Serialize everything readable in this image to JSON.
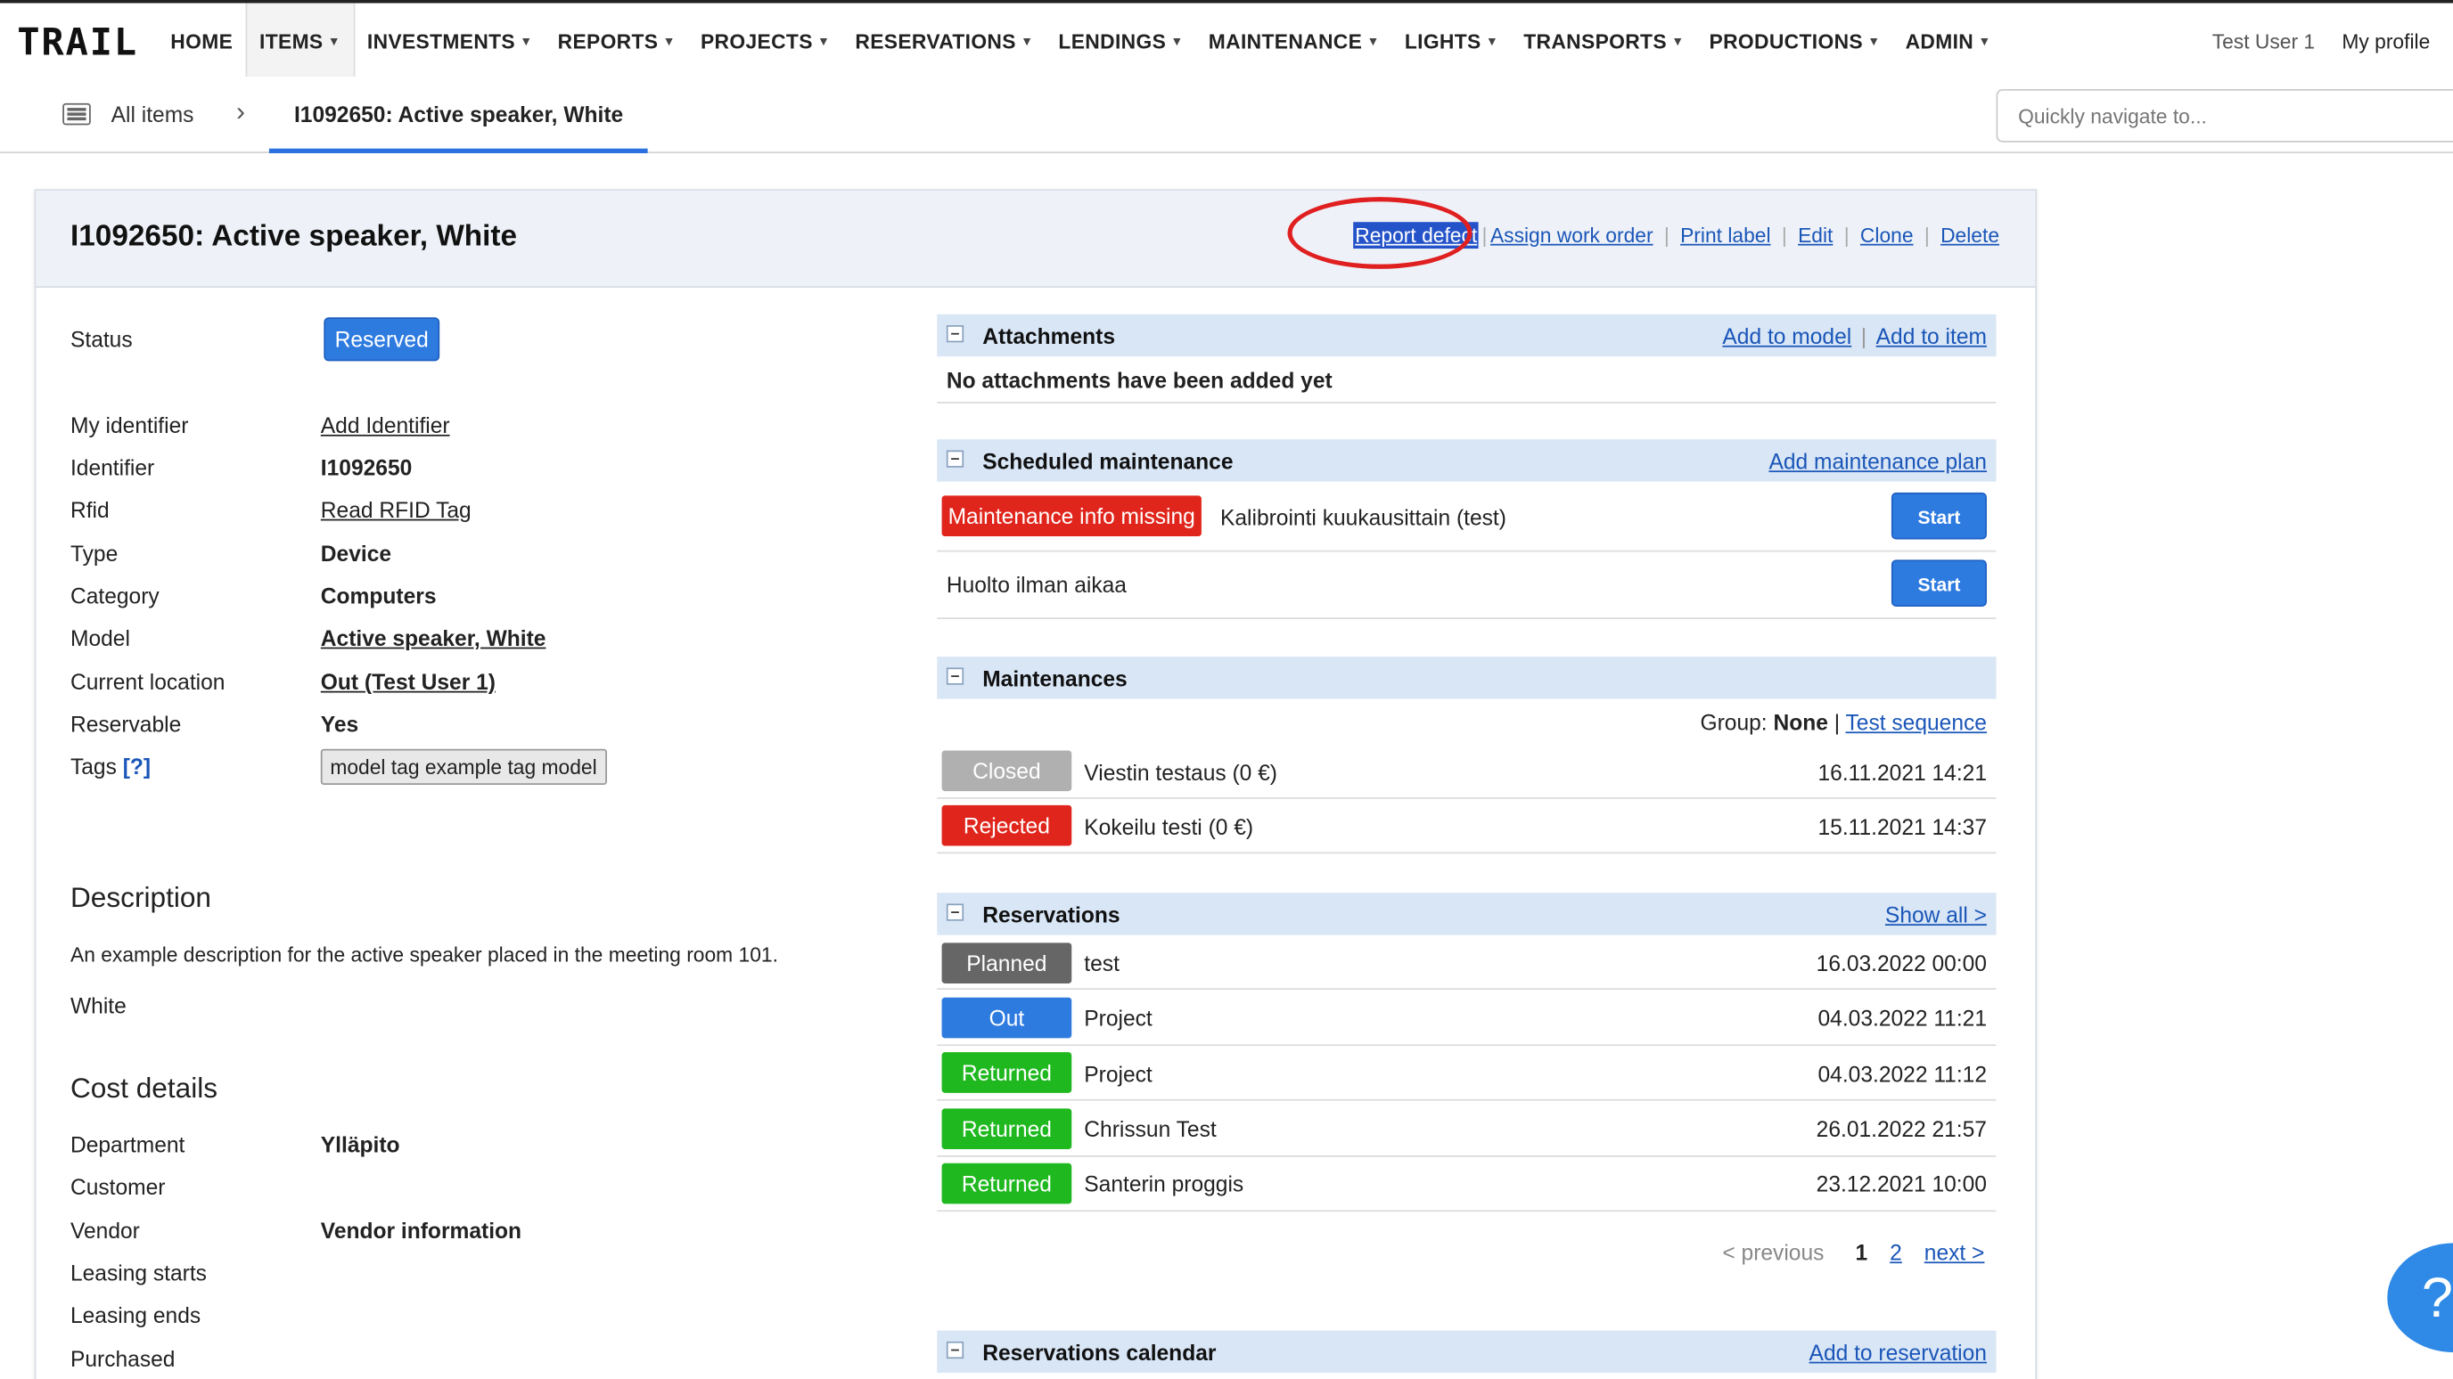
{
  "app": {
    "logo": "TRAIL"
  },
  "nav": {
    "items": [
      "HOME",
      "ITEMS",
      "INVESTMENTS",
      "REPORTS",
      "PROJECTS",
      "RESERVATIONS",
      "LENDINGS",
      "MAINTENANCE",
      "LIGHTS",
      "TRANSPORTS",
      "PRODUCTIONS",
      "ADMIN"
    ],
    "user": "Test User 1",
    "profile": "My profile"
  },
  "breadcrumb": {
    "all_items": "All items",
    "current": "I1092650: Active speaker, White"
  },
  "search": {
    "placeholder": "Quickly navigate to..."
  },
  "item": {
    "title": "I1092650: Active speaker, White",
    "actions": [
      "Report defect",
      "Assign work order",
      "Print label",
      "Edit",
      "Clone",
      "Delete"
    ],
    "status_label": "Status",
    "status": "Reserved",
    "fields": [
      {
        "label": "My identifier",
        "value": "Add Identifier"
      },
      {
        "label": "Identifier",
        "value": "I1092650"
      },
      {
        "label": "Rfid",
        "value": "Read RFID Tag"
      },
      {
        "label": "Type",
        "value": "Device"
      },
      {
        "label": "Category",
        "value": "Computers"
      },
      {
        "label": "Model",
        "value": "Active speaker, White"
      },
      {
        "label": "Current location",
        "value": "Out (Test User 1)"
      },
      {
        "label": "Reservable",
        "value": "Yes"
      }
    ],
    "tags_label": "Tags",
    "tags_help": "[?]",
    "tags": "model tag example tag model",
    "description_heading": "Description",
    "description": "An example description for the active speaker placed in the meeting room 101.",
    "color": "White",
    "cost_heading": "Cost details",
    "cost_fields": [
      {
        "label": "Department",
        "value": "Ylläpito"
      },
      {
        "label": "Customer",
        "value": ""
      },
      {
        "label": "Vendor",
        "value": "Vendor information"
      },
      {
        "label": "Leasing starts",
        "value": ""
      },
      {
        "label": "Leasing ends",
        "value": ""
      },
      {
        "label": "Purchased",
        "value": ""
      }
    ]
  },
  "attachments": {
    "title": "Attachments",
    "add_model": "Add to model",
    "add_item": "Add to item",
    "empty": "No attachments have been added yet"
  },
  "scheduled": {
    "title": "Scheduled maintenance",
    "add": "Add maintenance plan",
    "rows": [
      {
        "badge": "Maintenance info missing",
        "text": "Kalibrointi kuukausittain (test)",
        "button": "Start"
      },
      {
        "badge": "",
        "text": "Huolto ilman aikaa",
        "button": "Start"
      }
    ]
  },
  "maintenances": {
    "title": "Maintenances",
    "group_label": "Group:",
    "group_value": "None",
    "separator": "|",
    "sequence": "Test sequence",
    "rows": [
      {
        "status": "Closed",
        "text": "Viestin testaus (0 €)",
        "date": "16.11.2021 14:21"
      },
      {
        "status": "Rejected",
        "text": "Kokeilu testi (0 €)",
        "date": "15.11.2021 14:37"
      }
    ]
  },
  "reservations": {
    "title": "Reservations",
    "show_all": "Show all >",
    "rows": [
      {
        "status": "Planned",
        "text": "test",
        "date": "16.03.2022 00:00"
      },
      {
        "status": "Out",
        "text": "Project",
        "date": "04.03.2022 11:21"
      },
      {
        "status": "Returned",
        "text": "Project",
        "date": "04.03.2022 11:12"
      },
      {
        "status": "Returned",
        "text": "Chrissun Test",
        "date": "26.01.2022 21:57"
      },
      {
        "status": "Returned",
        "text": "Santerin proggis",
        "date": "23.12.2021 10:00"
      }
    ],
    "pager": {
      "previous": "< previous",
      "page1": "1",
      "page2": "2",
      "next": "next >"
    }
  },
  "calendar": {
    "title": "Reservations calendar",
    "add": "Add to reservation"
  },
  "help": {
    "label": "?"
  },
  "colors": {
    "blue": "#2e7be0",
    "red": "#e0261c",
    "green": "#1fb81f",
    "grey": "#b0b0b0",
    "dark": "#666666",
    "section": "#d9e6f6"
  }
}
